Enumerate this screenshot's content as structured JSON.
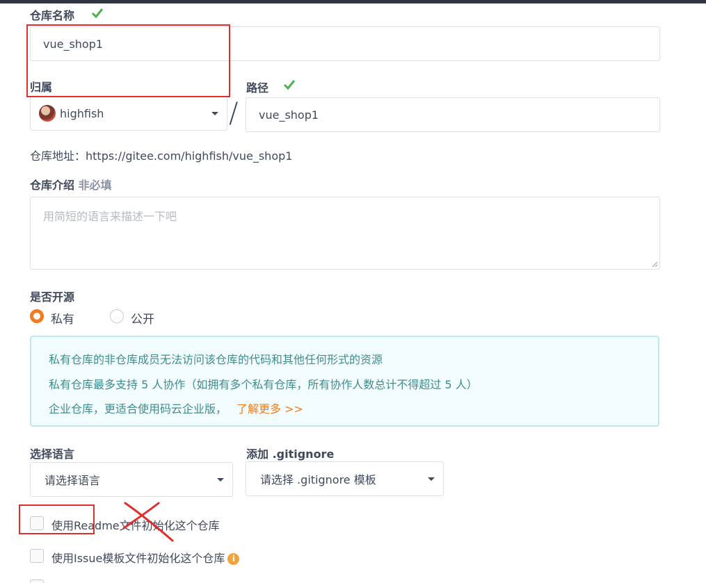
{
  "repo_name": {
    "label": "仓库名称",
    "value": "vue_shop1"
  },
  "owner": {
    "label": "归属",
    "value": "highfish"
  },
  "path": {
    "label": "路径",
    "value": "vue_shop1",
    "separator": "/"
  },
  "repo_address": {
    "text": "仓库地址：https://gitee.com/highfish/vue_shop1"
  },
  "description": {
    "label": "仓库介绍",
    "optional": "非必填",
    "placeholder": "用简短的语言来描述一下吧"
  },
  "visibility": {
    "label": "是否开源",
    "options": [
      {
        "label": "私有",
        "selected": true
      },
      {
        "label": "公开",
        "selected": false
      }
    ]
  },
  "info": {
    "line1": "私有仓库的非仓库成员无法访问该仓库的代码和其他任何形式的资源",
    "line2": "私有仓库最多支持 5 人协作（如拥有多个私有仓库，所有协作人数总计不得超过 5 人）",
    "line3": "企业仓库，更适合使用码云企业版，",
    "link": "了解更多 >>"
  },
  "language": {
    "label": "选择语言",
    "value": "请选择语言"
  },
  "gitignore": {
    "label": "添加 .gitignore",
    "value": "请选择 .gitignore 模板"
  },
  "checkboxes": [
    {
      "label": "使用Readme文件初始化这个仓库",
      "checked": false
    },
    {
      "label": "使用Issue模板文件初始化这个仓库",
      "checked": false
    }
  ],
  "icons": {
    "check": "check-icon",
    "caret": "caret-down-icon",
    "info": "info-icon"
  },
  "colors": {
    "accent": "#f37b1d",
    "success": "#4caf50",
    "info_text": "#3f8c8f",
    "annotation": "#e02e2e"
  }
}
